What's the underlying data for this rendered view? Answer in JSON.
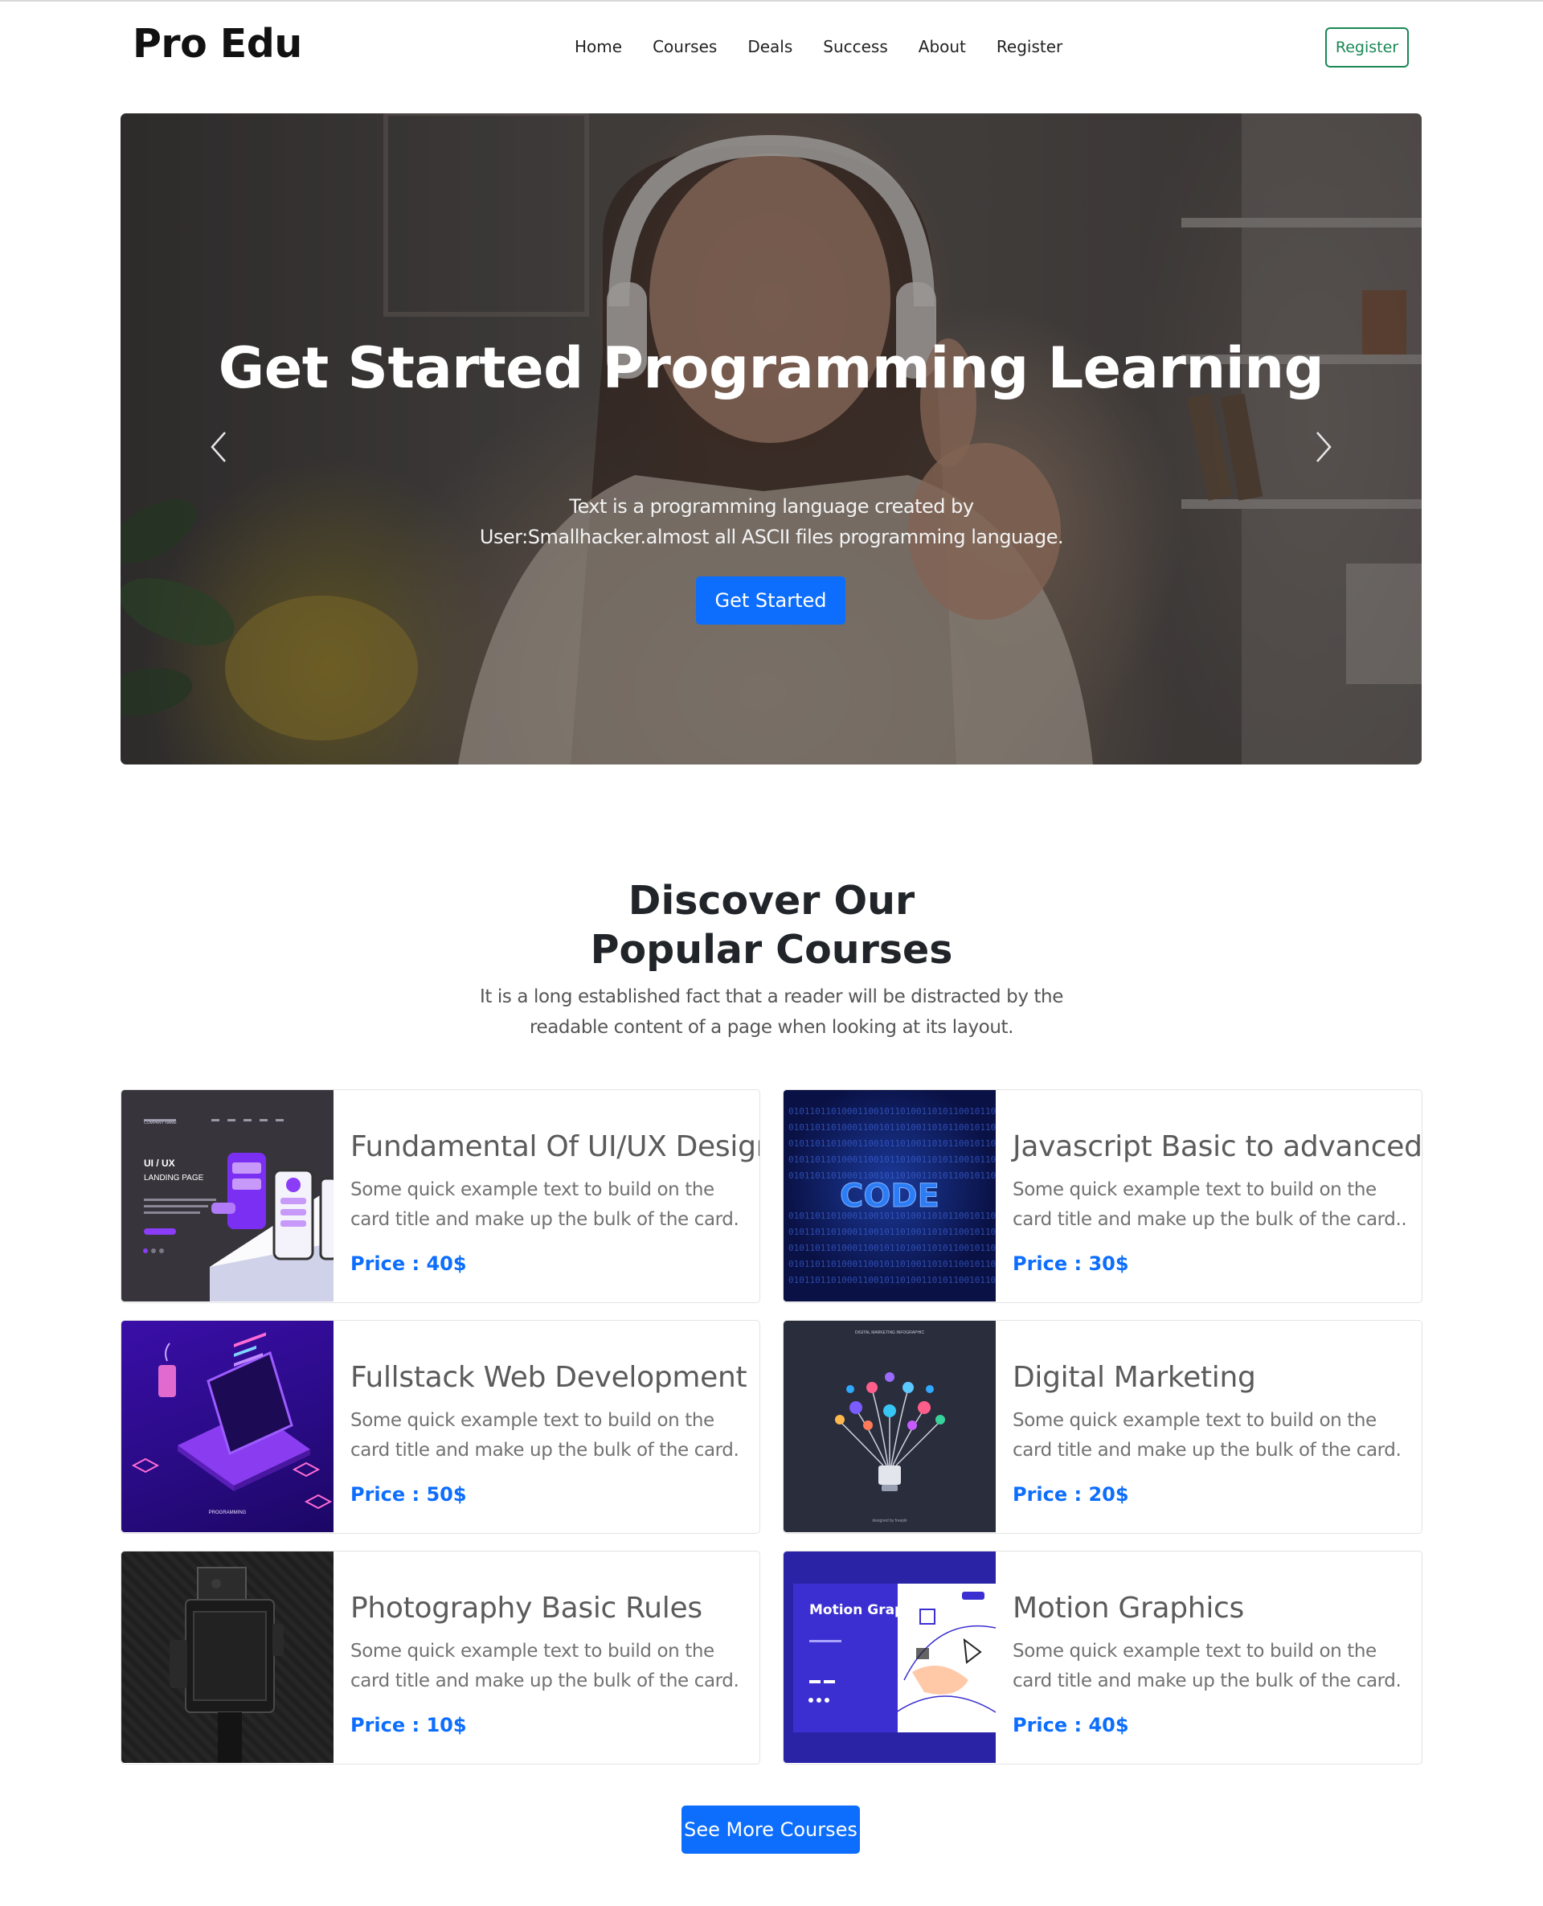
{
  "brand": "Pro Edu",
  "nav": {
    "links": [
      "Home",
      "Courses",
      "Deals",
      "Success",
      "About",
      "Register"
    ],
    "register_button": "Register"
  },
  "hero": {
    "title": "Get Started Programming Learning",
    "text": "Text is a programming language created by User:Smallhacker.almost all ASCII files programming language.",
    "button": "Get Started",
    "prev_icon": "chevron-left-icon",
    "next_icon": "chevron-right-icon"
  },
  "courses_section": {
    "title": "Discover Our Popular Courses",
    "subtitle": "It is a long established fact that a reader will be distracted by the readable content of a page when looking at its layout.",
    "more_button": "See More Courses"
  },
  "courses": [
    {
      "title": "Fundamental Of UI/UX Design",
      "text": "Some quick example text to build on the card title and make up the bulk of the card.",
      "price": "Price : 40$",
      "image": {
        "heading": "UI / UX",
        "subheading": "LANDING PAGE",
        "company": "COMPANY NAME"
      }
    },
    {
      "title": "Javascript Basic to advanced",
      "text": "Some quick example text to build on the card title and make up the bulk of the card..",
      "price": "Price : 30$",
      "image": {
        "word": "CODE",
        "binary": "0101101101000110010110100110101100101101"
      }
    },
    {
      "title": "Fullstack Web Development",
      "text": "Some quick example text to build on the card title and make up the bulk of the card.",
      "price": "Price : 50$",
      "image": {
        "caption": "PROGRAMMING"
      }
    },
    {
      "title": "Digital Marketing",
      "text": "Some quick example text to build on the card title and make up the bulk of the card.",
      "price": "Price : 20$",
      "image": {
        "caption": "DIGITAL MARKETING INFOGRAPHIC",
        "credit": "designed by freepik"
      }
    },
    {
      "title": "Photography Basic Rules",
      "text": "Some quick example text to build on the card title and make up the bulk of the card.",
      "price": "Price : 10$",
      "image": {}
    },
    {
      "title": "Motion Graphics",
      "text": "Some quick example text to build on the card title and make up the bulk of the card.",
      "price": "Price : 40$",
      "image": {
        "heading": "Motion Graphics"
      }
    }
  ],
  "colors": {
    "primary": "#0d6efd",
    "success": "#198754",
    "text": "#212529"
  }
}
